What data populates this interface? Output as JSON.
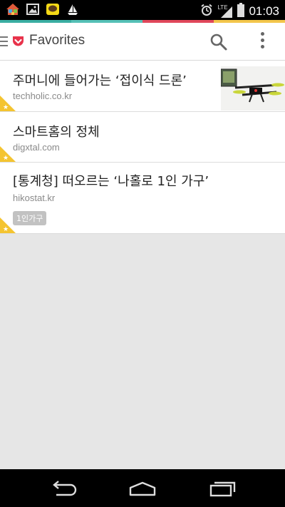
{
  "status_bar": {
    "time": "01:03",
    "network_label": "LTE",
    "icons": [
      "home-notification-icon",
      "image-notification-icon",
      "talk-notification-icon",
      "boat-notification-icon",
      "alarm-icon",
      "signal-icon",
      "battery-icon"
    ]
  },
  "color_strip": [
    "#3aaea2",
    "#55c0b6",
    "#e0475b",
    "#f3c64b"
  ],
  "app_bar": {
    "title": "Favorites",
    "accent_color": "#e8334b"
  },
  "items": [
    {
      "title": "주머니에 들어가는 ‘접이식 드론’",
      "domain": "techholic.co.kr",
      "has_thumbnail": true,
      "favorite": true
    },
    {
      "title": "스마트홈의 정체",
      "domain": "digxtal.com",
      "has_thumbnail": false,
      "favorite": true
    },
    {
      "title": "[통계청] 떠오르는 ‘나홀로 1인 가구’",
      "domain": "hikostat.kr",
      "tag": "1인가구",
      "has_thumbnail": false,
      "favorite": true
    }
  ],
  "nav_bar": {
    "buttons": [
      "back-icon",
      "home-icon",
      "recents-icon"
    ]
  }
}
